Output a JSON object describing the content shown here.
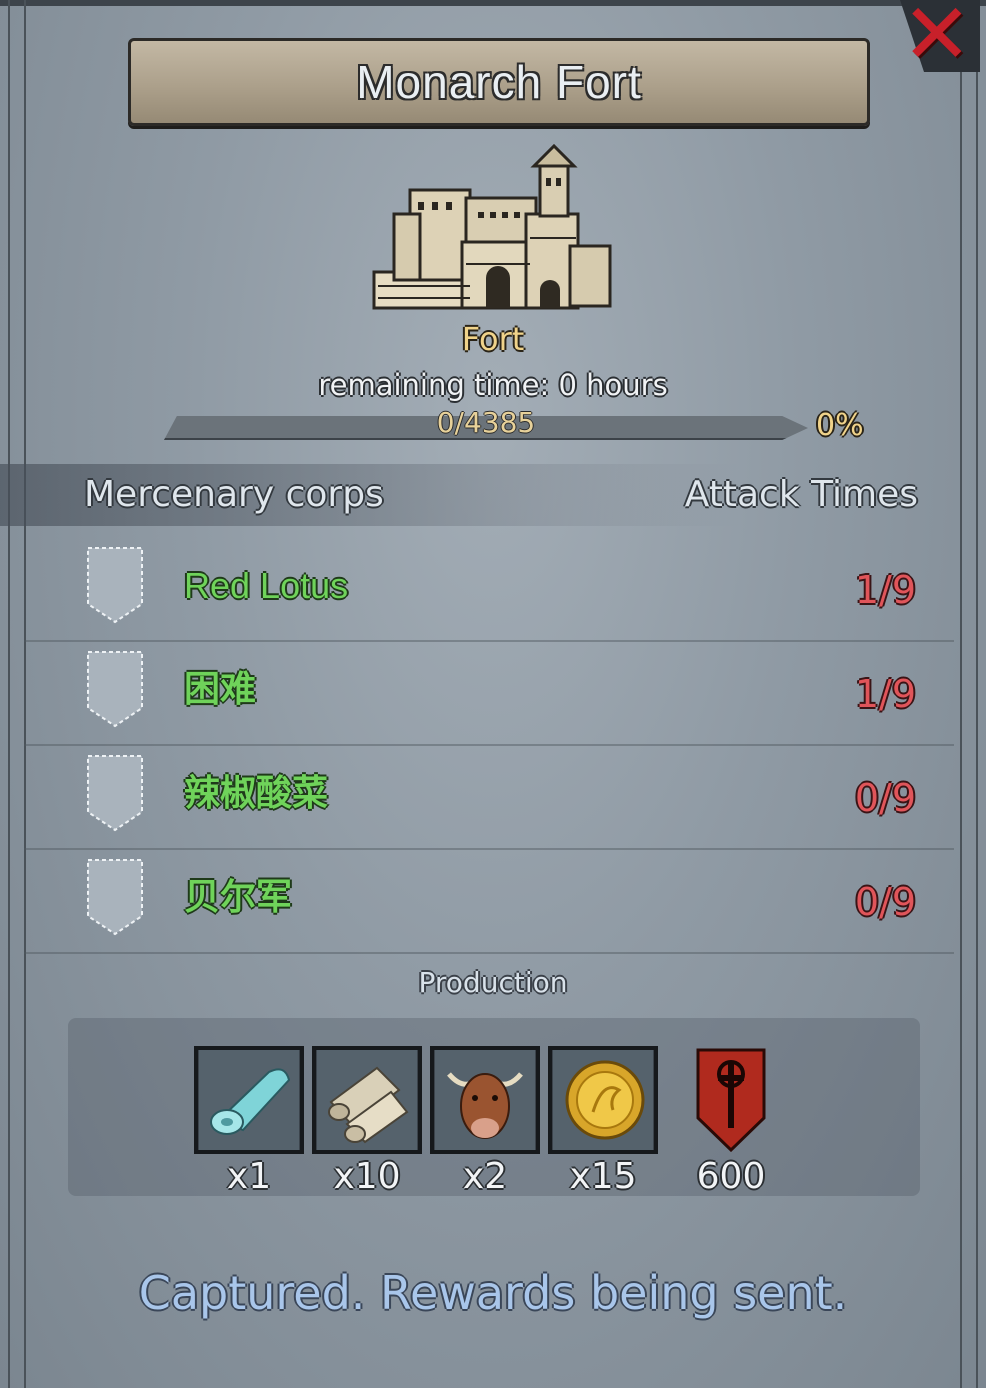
{
  "title": "Monarch Fort",
  "building": {
    "type_label": "Fort",
    "remaining": "remaining time: 0 hours"
  },
  "progress": {
    "text": "0/4385",
    "percent_label": "0%",
    "fraction": 0.0
  },
  "table": {
    "headers": {
      "corps": "Mercenary corps",
      "attacks": "Attack Times"
    },
    "rows": [
      {
        "name": "Red Lotus",
        "attacks": "1/9"
      },
      {
        "name": "困难",
        "attacks": "1/9"
      },
      {
        "name": "辣椒酸菜",
        "attacks": "0/9"
      },
      {
        "name": "贝尔军",
        "attacks": "0/9"
      }
    ]
  },
  "production": {
    "label": "Production",
    "items": [
      {
        "icon": "cloth-roll-icon",
        "qty": "x1"
      },
      {
        "icon": "paper-scroll-icon",
        "qty": "x10"
      },
      {
        "icon": "cattle-icon",
        "qty": "x2"
      },
      {
        "icon": "gold-coin-icon",
        "qty": "x15"
      },
      {
        "icon": "crest-emblem-icon",
        "qty": "600"
      }
    ]
  },
  "status": "Captured. Rewards being sent.",
  "colors": {
    "name_green": "#6fd35a",
    "count_red": "#e0555a",
    "gold": "#f0d38a",
    "close_red": "#c8202a"
  }
}
